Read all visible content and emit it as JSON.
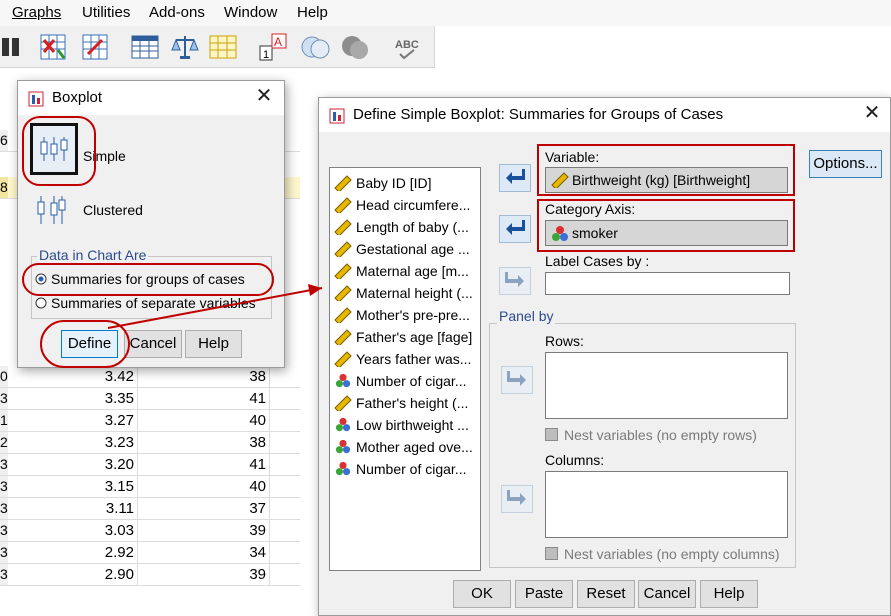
{
  "menu": [
    "Graphs",
    "Utilities",
    "Add-ons",
    "Window",
    "Help"
  ],
  "toolbar_icons": [
    "binoculars-icon",
    "insert-cases-icon",
    "insert-variable-icon",
    "split-file-icon",
    "weight-cases-icon",
    "select-cases-icon",
    "value-labels-icon",
    "use-sets-icon",
    "show-all-variables-icon",
    "spell-check-icon"
  ],
  "grid": {
    "row_numbers": [
      "6",
      "",
      "8",
      "",
      "",
      "",
      "",
      "",
      "",
      "",
      "",
      "",
      "",
      "",
      "",
      "",
      "",
      "",
      "",
      "",
      "",
      ""
    ],
    "rows": [
      {
        "n": "0",
        "c1": "3.42",
        "c2": "38"
      },
      {
        "n": "3",
        "c1": "3.35",
        "c2": "41"
      },
      {
        "n": "1",
        "c1": "3.27",
        "c2": "40"
      },
      {
        "n": "2",
        "c1": "3.23",
        "c2": "38"
      },
      {
        "n": "3",
        "c1": "3.20",
        "c2": "41"
      },
      {
        "n": "3",
        "c1": "3.15",
        "c2": "40"
      },
      {
        "n": "3",
        "c1": "3.11",
        "c2": "37"
      },
      {
        "n": "3",
        "c1": "3.03",
        "c2": "39"
      },
      {
        "n": "3",
        "c1": "2.92",
        "c2": "34"
      },
      {
        "n": "3",
        "c1": "2.90",
        "c2": "39"
      }
    ]
  },
  "boxplot_dialog": {
    "title": "Boxplot",
    "close": "✕",
    "options": [
      "Simple",
      "Clustered"
    ],
    "group_title": "Data in Chart Are",
    "radio": [
      "Summaries for groups of cases",
      "Summaries of separate variables"
    ],
    "buttons": {
      "define": "Define",
      "cancel": "Cancel",
      "help": "Help"
    }
  },
  "define_dialog": {
    "title": "Define Simple Boxplot: Summaries for Groups of Cases",
    "close": "✕",
    "variables": [
      {
        "label": "Baby ID [ID]",
        "icon": "scale"
      },
      {
        "label": "Head circumfere...",
        "icon": "scale"
      },
      {
        "label": "Length of baby (...",
        "icon": "scale"
      },
      {
        "label": "Gestational age ...",
        "icon": "scale"
      },
      {
        "label": "Maternal age [m...",
        "icon": "scale"
      },
      {
        "label": "Maternal height (...",
        "icon": "scale"
      },
      {
        "label": "Mother's pre-pre...",
        "icon": "scale"
      },
      {
        "label": "Father's age [fage]",
        "icon": "scale"
      },
      {
        "label": "Years father was...",
        "icon": "scale"
      },
      {
        "label": "Number of cigar...",
        "icon": "nominal"
      },
      {
        "label": "Father's height (...",
        "icon": "scale"
      },
      {
        "label": "Low birthweight ...",
        "icon": "nominal"
      },
      {
        "label": "Mother aged ove...",
        "icon": "nominal"
      },
      {
        "label": "Number of cigar...",
        "icon": "nominal"
      }
    ],
    "variable_label": "Variable:",
    "variable_value": "Birthweight (kg) [Birthweight]",
    "category_label": "Category Axis:",
    "category_value": "smoker",
    "label_cases": "Label Cases by :",
    "panel_by": "Panel by",
    "rows_label": "Rows:",
    "nest_rows": "Nest variables (no empty rows)",
    "columns_label": "Columns:",
    "nest_columns": "Nest variables (no empty columns)",
    "options_button": "Options...",
    "buttons": {
      "ok": "OK",
      "paste": "Paste",
      "reset": "Reset",
      "cancel": "Cancel",
      "help": "Help"
    }
  },
  "colors": {
    "annotation": "#c00000",
    "scale_icon": "#e8b800",
    "nominal_red": "#d93030",
    "nominal_green": "#3aa63a",
    "nominal_blue": "#3b6fd4"
  }
}
